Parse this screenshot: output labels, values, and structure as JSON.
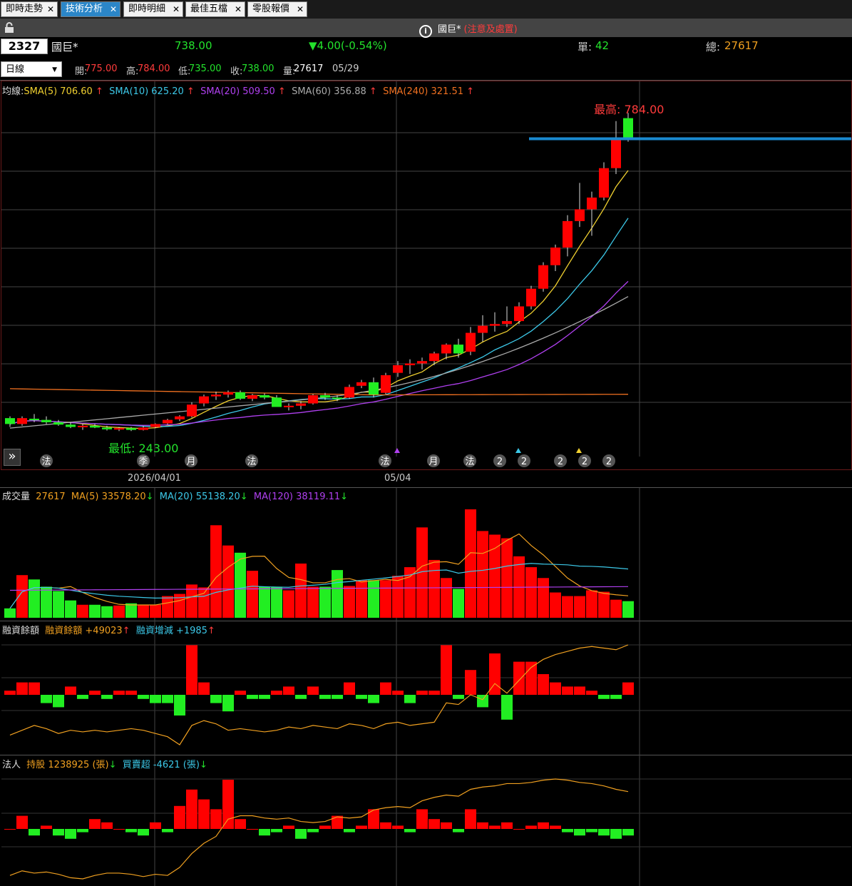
{
  "tabs": [
    {
      "label": "即時走勢",
      "active": false
    },
    {
      "label": "技術分析",
      "active": true
    },
    {
      "label": "即時明細",
      "active": false
    },
    {
      "label": "最佳五檔",
      "active": false
    },
    {
      "label": "零股報價",
      "active": false
    }
  ],
  "tab_close": "✕",
  "title": {
    "name": "國巨*",
    "warning": "(注意及處置)"
  },
  "quote": {
    "code": "2327",
    "name": "國巨*",
    "price": "738.00",
    "change": "▼4.00(-0.54%)",
    "single_label": "單:",
    "single": "42",
    "total_label": "總:",
    "total": "27617"
  },
  "period": {
    "selected": "日線"
  },
  "ohlc": {
    "open_label": "開:",
    "open": "775.00",
    "high_label": "高:",
    "high": "784.00",
    "low_label": "低:",
    "low": "735.00",
    "close_label": "收:",
    "close": "738.00",
    "vol_label": "量:",
    "vol": "27617",
    "date": "05/29"
  },
  "sma_legend": {
    "label": "均線:",
    "items": [
      {
        "text": "SMA(5) 706.60",
        "color": "#f0d030",
        "arrow": "↑"
      },
      {
        "text": "SMA(10) 625.20",
        "color": "#3cc8e8",
        "arrow": "↑"
      },
      {
        "text": "SMA(20) 509.50",
        "color": "#b040f0",
        "arrow": "↑"
      },
      {
        "text": "SMA(60) 356.88",
        "color": "#aaaaaa",
        "arrow": "↑"
      },
      {
        "text": "SMA(240) 321.51",
        "color": "#f07020",
        "arrow": "↑"
      }
    ]
  },
  "price_labels": {
    "high": "最高: 784.00",
    "low": "最低: 243.00"
  },
  "date_labels": [
    "2026/04/01",
    "05/04"
  ],
  "event_markers": [
    "法",
    "季",
    "月",
    "法",
    "法",
    "月",
    "法",
    "2",
    "2",
    "2",
    "2",
    "2"
  ],
  "volume_legend": {
    "label": "成交量",
    "value": "27617",
    "items": [
      {
        "text": "MA(5) 33578.20",
        "color": "#f0a020",
        "arrow": "↓"
      },
      {
        "text": "MA(20) 55138.20",
        "color": "#3cc8e8",
        "arrow": "↓"
      },
      {
        "text": "MA(120) 38119.11",
        "color": "#b040f0",
        "arrow": "↓"
      }
    ]
  },
  "margin_legend": {
    "label": "融資餘額",
    "items": [
      {
        "text": "融資餘額 +49023",
        "color": "#f0a020",
        "arrow": "↑"
      },
      {
        "text": "融資增減 +1985",
        "color": "#3cc8e8",
        "arrow": "↑"
      }
    ]
  },
  "inst_legend": {
    "label": "法人",
    "items": [
      {
        "text": "持股 1238925 (張)",
        "color": "#f0a020",
        "arrow": "↓"
      },
      {
        "text": "買賣超 -4621 (張)",
        "color": "#3cc8e8",
        "arrow": "↓"
      }
    ]
  },
  "colors": {
    "up": "#ff0000",
    "down": "#22ee22",
    "hline": "#1a8ad0"
  },
  "chart_data": {
    "type": "candlestick",
    "count": 52,
    "ylim": [
      230,
      800
    ],
    "hline": 740,
    "candles": [
      [
        265,
        268,
        250,
        255
      ],
      [
        255,
        268,
        252,
        265
      ],
      [
        264,
        272,
        258,
        262
      ],
      [
        262,
        268,
        255,
        258
      ],
      [
        258,
        262,
        252,
        254
      ],
      [
        254,
        258,
        248,
        250
      ],
      [
        250,
        255,
        245,
        252
      ],
      [
        252,
        255,
        248,
        249
      ],
      [
        249,
        252,
        244,
        246
      ],
      [
        246,
        250,
        243,
        248
      ],
      [
        248,
        250,
        243,
        245
      ],
      [
        245,
        252,
        244,
        249
      ],
      [
        250,
        256,
        248,
        255
      ],
      [
        256,
        264,
        254,
        262
      ],
      [
        263,
        270,
        260,
        268
      ],
      [
        268,
        292,
        266,
        288
      ],
      [
        290,
        305,
        285,
        302
      ],
      [
        302,
        310,
        296,
        305
      ],
      [
        305,
        312,
        300,
        309
      ],
      [
        309,
        312,
        296,
        298
      ],
      [
        298,
        306,
        294,
        304
      ],
      [
        304,
        307,
        297,
        300
      ],
      [
        300,
        304,
        288,
        284
      ],
      [
        284,
        290,
        278,
        286
      ],
      [
        286,
        294,
        280,
        290
      ],
      [
        290,
        306,
        288,
        304
      ],
      [
        304,
        308,
        296,
        300
      ],
      [
        300,
        304,
        294,
        298
      ],
      [
        300,
        322,
        298,
        318
      ],
      [
        320,
        330,
        316,
        326
      ],
      [
        326,
        334,
        300,
        305
      ],
      [
        308,
        342,
        306,
        338
      ],
      [
        342,
        362,
        335,
        355
      ],
      [
        355,
        365,
        340,
        358
      ],
      [
        358,
        368,
        348,
        362
      ],
      [
        362,
        378,
        355,
        375
      ],
      [
        375,
        392,
        365,
        390
      ],
      [
        390,
        400,
        368,
        375
      ],
      [
        378,
        420,
        372,
        410
      ],
      [
        410,
        440,
        395,
        422
      ],
      [
        422,
        445,
        412,
        425
      ],
      [
        425,
        455,
        420,
        430
      ],
      [
        430,
        462,
        425,
        455
      ],
      [
        455,
        490,
        450,
        485
      ],
      [
        485,
        530,
        480,
        525
      ],
      [
        525,
        560,
        515,
        555
      ],
      [
        555,
        610,
        540,
        600
      ],
      [
        600,
        665,
        590,
        620
      ],
      [
        620,
        650,
        575,
        640
      ],
      [
        640,
        700,
        635,
        690
      ],
      [
        690,
        770,
        680,
        742
      ],
      [
        775,
        784,
        735,
        738
      ]
    ],
    "volume": [
      13,
      59,
      53,
      43,
      37,
      24,
      18,
      18,
      16,
      17,
      20,
      18,
      18,
      30,
      33,
      46,
      42,
      128,
      100,
      90,
      65,
      43,
      43,
      38,
      75,
      43,
      43,
      66,
      44,
      52,
      52,
      52,
      58,
      70,
      125,
      80,
      55,
      40,
      150,
      120,
      115,
      110,
      85,
      70,
      55,
      35,
      30,
      30,
      38,
      36,
      25,
      23
    ],
    "margin_change": [
      1,
      3,
      3,
      -2,
      -3,
      2,
      -1,
      1,
      -1,
      1,
      1,
      -1,
      -2,
      -2,
      -5,
      12,
      3,
      -2,
      -4,
      1,
      -1,
      -1,
      1,
      2,
      -1,
      2,
      -1,
      -1,
      3,
      -1,
      -2,
      3,
      1,
      -2,
      1,
      1,
      12,
      -1,
      6,
      -3,
      10,
      -6,
      8,
      8,
      5,
      3,
      2,
      2,
      1,
      -1,
      -1,
      3
    ],
    "inst_net": [
      0,
      4,
      -2,
      1,
      -2,
      -3,
      -1,
      3,
      2,
      0,
      -1,
      -2,
      2,
      -1,
      7,
      12,
      9,
      6,
      15,
      3,
      0,
      -2,
      -1,
      1,
      -3,
      -1,
      1,
      4,
      -1,
      1,
      6,
      2,
      1,
      -1,
      6,
      3,
      2,
      -1,
      6,
      2,
      1,
      2,
      0,
      1,
      2,
      1,
      -1,
      -2,
      -1,
      -2,
      -3,
      -2
    ]
  }
}
